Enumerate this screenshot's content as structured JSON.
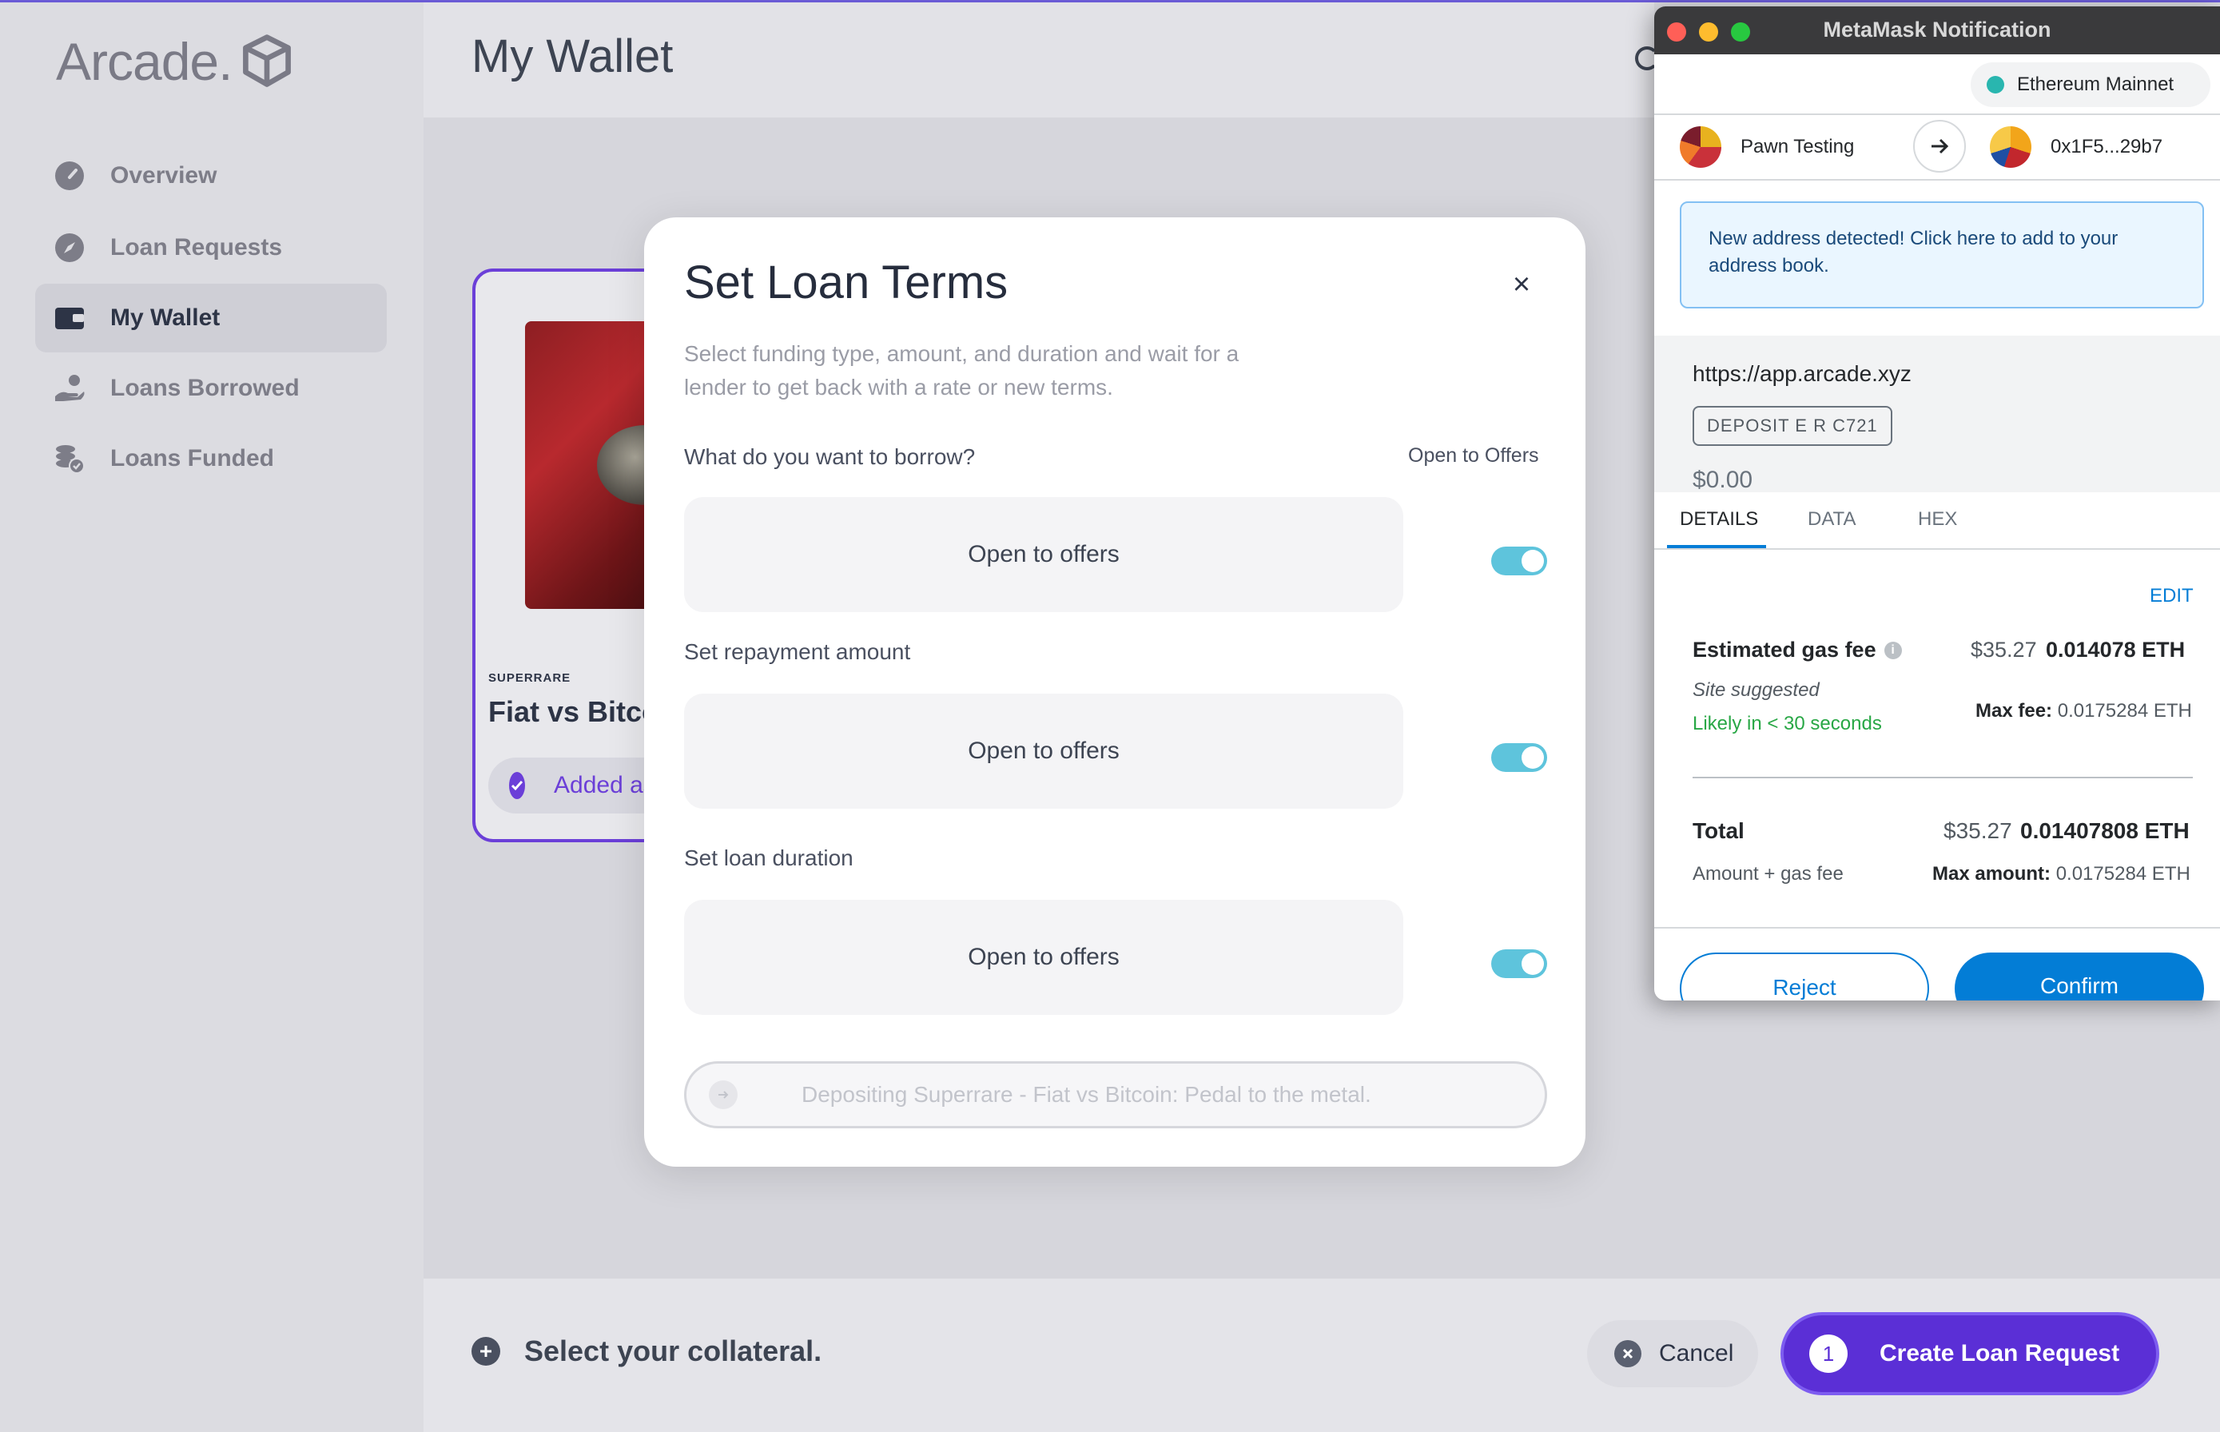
{
  "app": {
    "logo_text": "Arcade.",
    "page_title": "My Wallet"
  },
  "sidebar": {
    "items": [
      {
        "label": "Overview",
        "icon": "gauge-icon"
      },
      {
        "label": "Loan Requests",
        "icon": "compass-icon"
      },
      {
        "label": "My Wallet",
        "icon": "wallet-icon",
        "active": true
      },
      {
        "label": "Loans Borrowed",
        "icon": "hand-coin-icon"
      },
      {
        "label": "Loans Funded",
        "icon": "coins-check-icon"
      }
    ]
  },
  "nft_card": {
    "source": "SUPERRARE",
    "title": "Fiat vs Bitcoin: Pedal to the metal.",
    "added_label": "Added as collateral"
  },
  "modal": {
    "title": "Set Loan Terms",
    "close_symbol": "×",
    "subtitle": "Select funding type, amount, and duration and wait for a lender to get back with a rate or new terms.",
    "borrow_label": "What do you want to borrow?",
    "open_to_offers_label": "Open to Offers",
    "borrow_value": "Open to offers",
    "repayment_label": "Set repayment amount",
    "repayment_value": "Open to offers",
    "duration_label": "Set loan duration",
    "duration_value": "Open to offers",
    "toggles": {
      "borrow": true,
      "repayment": true,
      "duration": true
    },
    "deposit_label": "Depositing Superrare - Fiat vs Bitcoin: Pedal to the metal."
  },
  "bottom_bar": {
    "select_label": "Select your collateral.",
    "cancel_label": "Cancel",
    "step_number": "1",
    "create_label": "Create Loan Request"
  },
  "metamask": {
    "window_title": "MetaMask Notification",
    "network": "Ethereum Mainnet",
    "from_account": "Pawn Testing",
    "to_address": "0x1F5...29b7",
    "notice": "New address detected! Click here to add to your address book.",
    "origin": "https://app.arcade.xyz",
    "method": "DEPOSIT E R C721",
    "amount": "$0.00",
    "tabs": [
      "DETAILS",
      "DATA",
      "HEX"
    ],
    "edit_label": "EDIT",
    "gas_label": "Estimated gas fee",
    "gas_usd": "$35.27",
    "gas_eth": "0.014078 ETH",
    "site_suggested": "Site suggested",
    "likely": "Likely in < 30 seconds",
    "max_fee_label": "Max fee:",
    "max_fee_value": "0.0175284 ETH",
    "total_label": "Total",
    "total_usd": "$35.27",
    "total_eth": "0.01407808 ETH",
    "amount_gas_label": "Amount + gas fee",
    "max_amount_label": "Max amount:",
    "max_amount_value": "0.0175284 ETH",
    "reject_label": "Reject",
    "confirm_label": "Confirm"
  },
  "colors": {
    "accent_purple": "#5b2fd6",
    "toggle_on": "#5ec4dc",
    "metamask_blue": "#037dd6",
    "success_green": "#28a745"
  }
}
